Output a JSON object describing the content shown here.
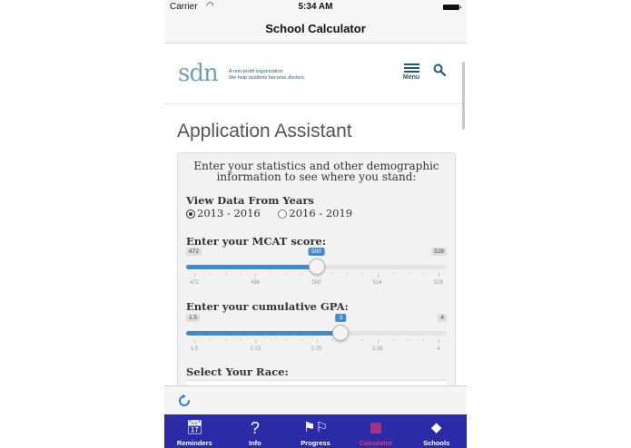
{
  "status_bar": {
    "carrier": "Carrier",
    "time": "5:34 AM"
  },
  "nav": {
    "title": "School Calculator"
  },
  "site": {
    "logo": "sdn",
    "tagline_line1": "A non-profit organization",
    "tagline_line2": "We help students become doctors",
    "menu_label": "Menu"
  },
  "page": {
    "title": "Application Assistant"
  },
  "form": {
    "intro": "Enter your statistics and other demographic information to see where you stand:",
    "years_label": "View Data From Years",
    "years_options": [
      {
        "label": "2013 - 2016",
        "selected": true
      },
      {
        "label": "2016 - 2019",
        "selected": false
      }
    ],
    "mcat": {
      "label": "Enter your MCAT score:",
      "min": "472",
      "max": "528",
      "value": "500",
      "fraction": 0.5,
      "ticks": [
        "472",
        "486",
        "500",
        "514",
        "528"
      ]
    },
    "gpa": {
      "label": "Enter your cumulative GPA:",
      "min": "1.5",
      "max": "4",
      "value": "3",
      "fraction": 0.6,
      "ticks": [
        "1.5",
        "2.13",
        "2.75",
        "3.38",
        "4"
      ]
    },
    "race_label": "Select Your Race:"
  },
  "tabs": [
    {
      "label": "Reminders",
      "icon": "calendar-icon",
      "active": false
    },
    {
      "label": "Info",
      "icon": "question-icon",
      "active": false
    },
    {
      "label": "Progress",
      "icon": "flags-icon",
      "active": false
    },
    {
      "label": "Calculator",
      "icon": "calculator-icon",
      "active": true
    },
    {
      "label": "Schools",
      "icon": "graduation-cap-icon",
      "active": false
    }
  ],
  "colors": {
    "accent": "#428bca",
    "tabbar": "#2b2ba8",
    "active_tab": "#e23a6a",
    "brand": "#1e5878"
  }
}
